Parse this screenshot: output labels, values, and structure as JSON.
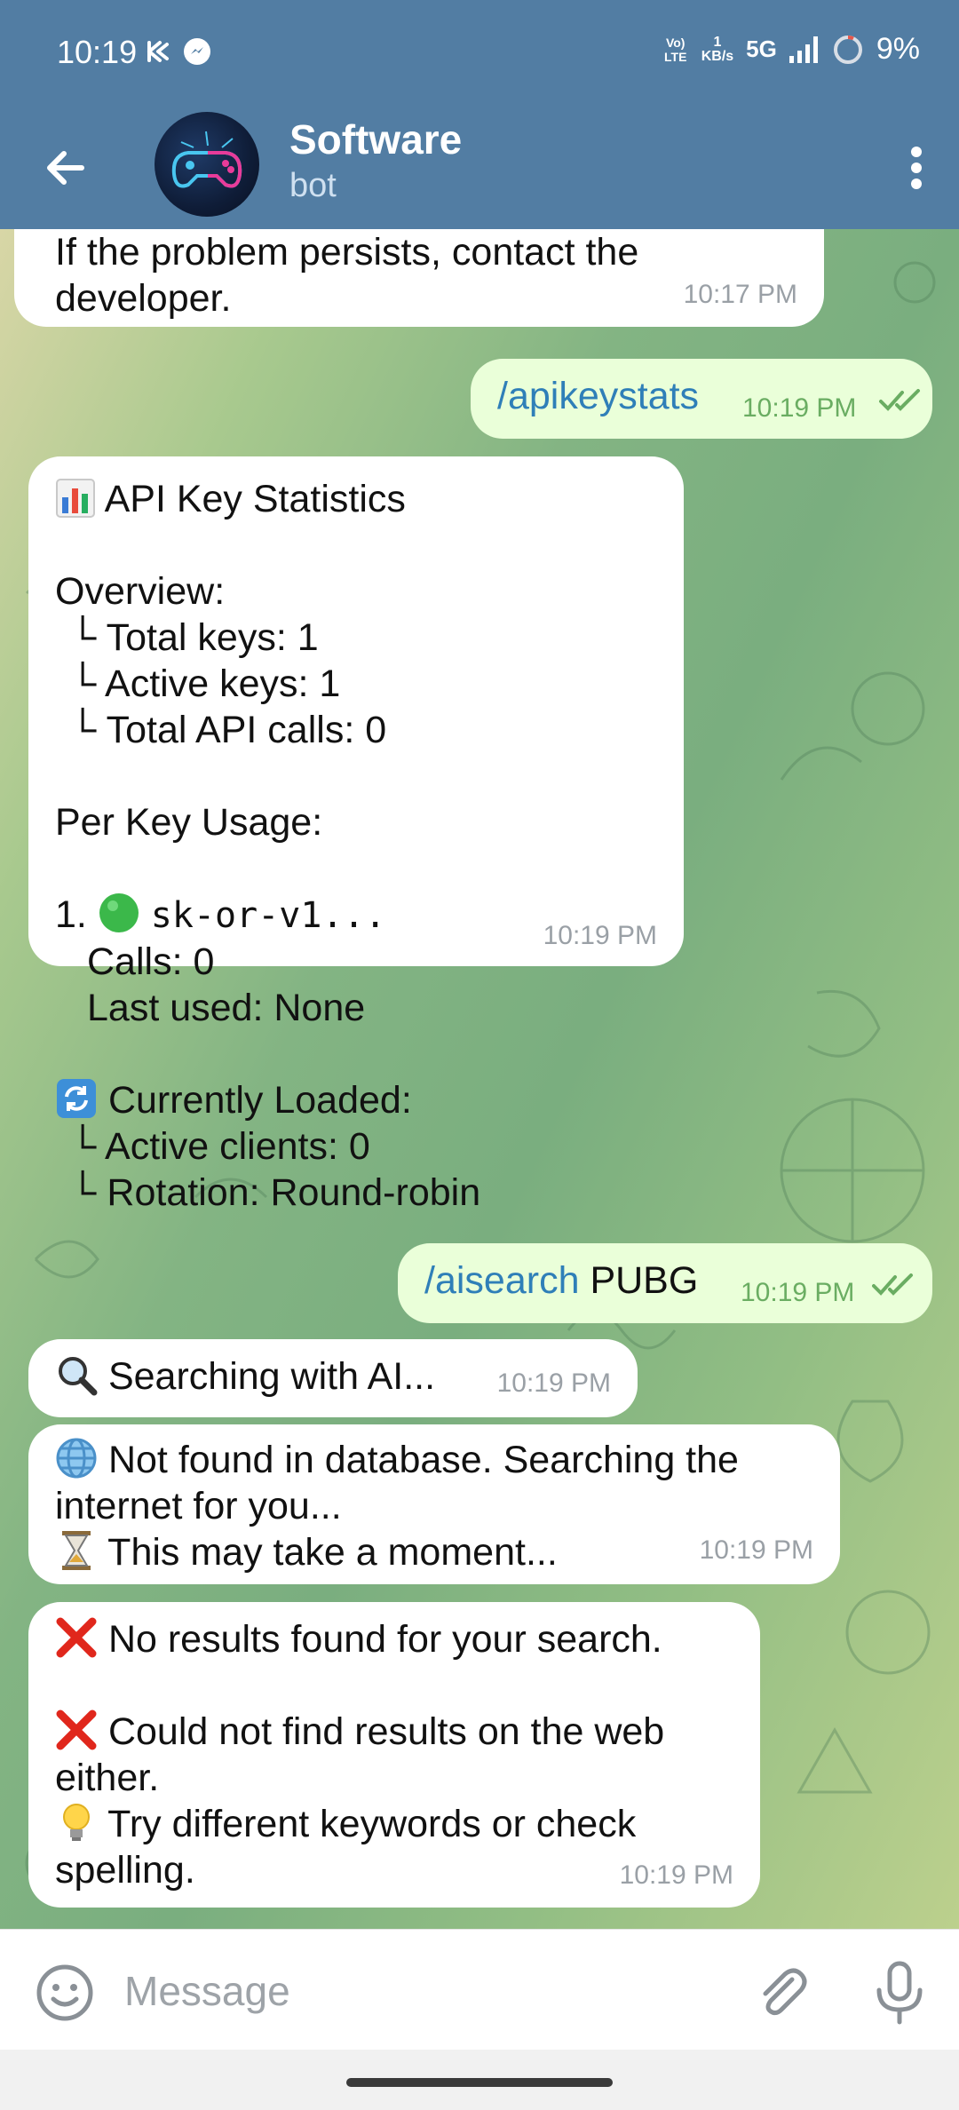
{
  "status_bar": {
    "time": "10:19",
    "lte_label": "Vo) LTE",
    "speed_value": "1",
    "speed_unit": "KB/s",
    "network": "5G",
    "battery": "9%"
  },
  "header": {
    "title": "Software",
    "subtitle": "bot",
    "back_icon": "arrow-left-icon",
    "menu_icon": "more-vert-icon"
  },
  "messages": [
    {
      "text": "If the problem persists, contact the\ndeveloper.",
      "time": "10:17 PM"
    },
    {
      "command": "/apikeystats",
      "time": "10:19 PM"
    },
    {
      "title": "API Key Statistics",
      "overview_label": "Overview:",
      "overview_items": [
        "Total keys: 1",
        "Active keys: 1",
        "Total API calls: 0"
      ],
      "per_key_label": "Per Key Usage:",
      "key_index": "1.",
      "key_name": "sk-or-v1...",
      "key_calls": "Calls: 0",
      "key_last_used": "Last used: None",
      "loaded_label": "Currently Loaded:",
      "loaded_items": [
        "Active clients: 0",
        "Rotation: Round-robin"
      ],
      "time": "10:19 PM"
    },
    {
      "command": "/aisearch",
      "argument": "PUBG",
      "time": "10:19 PM"
    },
    {
      "text": "Searching with AI...",
      "time": "10:19 PM"
    },
    {
      "line1": "Not found in database. Searching the",
      "line2": "internet for you...",
      "line3": "This may take a moment...",
      "time": "10:19 PM"
    },
    {
      "line1": "No results found for your search.",
      "line2": "Could not find results on the web",
      "line3": "either.",
      "line4": "Try different keywords or check",
      "line5": "spelling.",
      "time": "10:19 PM"
    }
  ],
  "composer": {
    "placeholder": "Message",
    "emoji_icon": "smile-icon",
    "attach_icon": "paperclip-icon",
    "mic_icon": "microphone-icon"
  },
  "colors": {
    "header": "#527da3",
    "outgoing_bubble": "#eaffd9",
    "incoming_bubble": "#ffffff",
    "command_link": "#2f7fb8",
    "read_ticks": "#6aad62"
  }
}
